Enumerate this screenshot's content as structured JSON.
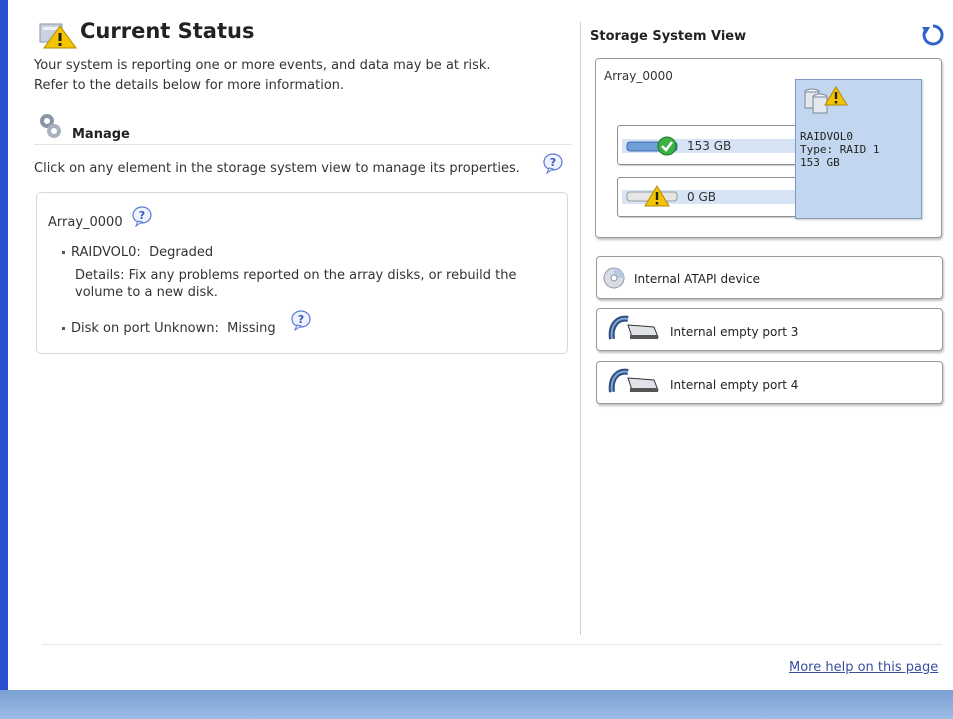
{
  "status": {
    "title": "Current Status",
    "line1": "Your system is reporting one or more events, and data may be at risk.",
    "line2": "Refer to the details below for more information."
  },
  "manage": {
    "title": "Manage",
    "description": "Click on any element in the storage system view to manage its properties."
  },
  "array_details": {
    "title": "Array_0000",
    "volume_line_name": "RAIDVOL0:",
    "volume_line_state": "Degraded",
    "details_line1": "Details: Fix any problems reported on the array disks, or rebuild the",
    "details_line2": "volume to a new disk.",
    "disk_line_name": "Disk on port Unknown:",
    "disk_line_state": "Missing"
  },
  "storage_view": {
    "title": "Storage System View",
    "array_label": "Array_0000",
    "disks": [
      {
        "size": "153 GB",
        "status": "ok"
      },
      {
        "size": "0 GB",
        "status": "warning"
      }
    ],
    "volume": {
      "name": "RAIDVOL0",
      "type": "Type: RAID 1",
      "size": "153 GB"
    },
    "devices": [
      {
        "label": "Internal ATAPI device",
        "icon": "cd-drive-icon"
      },
      {
        "label": "Internal empty port 3",
        "icon": "empty-port-icon"
      },
      {
        "label": "Internal empty port 4",
        "icon": "empty-port-icon"
      }
    ]
  },
  "footer": {
    "help_link": "More help on this page"
  },
  "colors": {
    "accent_blue": "#2a4fd0",
    "volume_card": "#c2d6ef",
    "warning": "#f5c400",
    "ok_green": "#3cb043",
    "link": "#3a4fa0"
  }
}
